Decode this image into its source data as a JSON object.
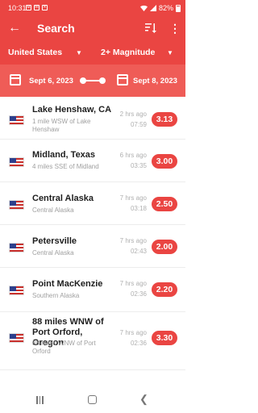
{
  "status_bar": {
    "time": "10:31",
    "notif_icons": [
      "M",
      "✉",
      "✕"
    ],
    "battery": "82%"
  },
  "app_bar": {
    "title": "Search",
    "back_icon": "arrow-back-icon",
    "sort_icon": "sort-icon",
    "more_icon": "more-vertical-icon"
  },
  "filters": {
    "country": "United States",
    "magnitude": "2+ Magnitude"
  },
  "dates": {
    "start": "Sept 6, 2023",
    "end": "Sept 8, 2023"
  },
  "quakes": [
    {
      "place": "Lake Henshaw, CA",
      "detail": "1 mile WSW of Lake Henshaw",
      "ago": "2 hrs ago",
      "time": "07:59",
      "magnitude": "3.13"
    },
    {
      "place": "Midland, Texas",
      "detail": "4 miles SSE of Midland",
      "ago": "6 hrs ago",
      "time": "03:35",
      "magnitude": "3.00"
    },
    {
      "place": "Central Alaska",
      "detail": "Central Alaska",
      "ago": "7 hrs ago",
      "time": "03:18",
      "magnitude": "2.50"
    },
    {
      "place": "Petersville",
      "detail": "Central Alaska",
      "ago": "7 hrs ago",
      "time": "02:43",
      "magnitude": "2.00"
    },
    {
      "place": "Point MacKenzie",
      "detail": "Southern Alaska",
      "ago": "7 hrs ago",
      "time": "02:36",
      "magnitude": "2.20"
    },
    {
      "place": "88 miles WNW of Port Orford, Oregon",
      "detail": "88 miles WNW of Port Orford",
      "ago": "7 hrs ago",
      "time": "02:36",
      "magnitude": "3.30"
    }
  ],
  "colors": {
    "accent": "#ea4542",
    "date_bar": "#ef5c57"
  }
}
